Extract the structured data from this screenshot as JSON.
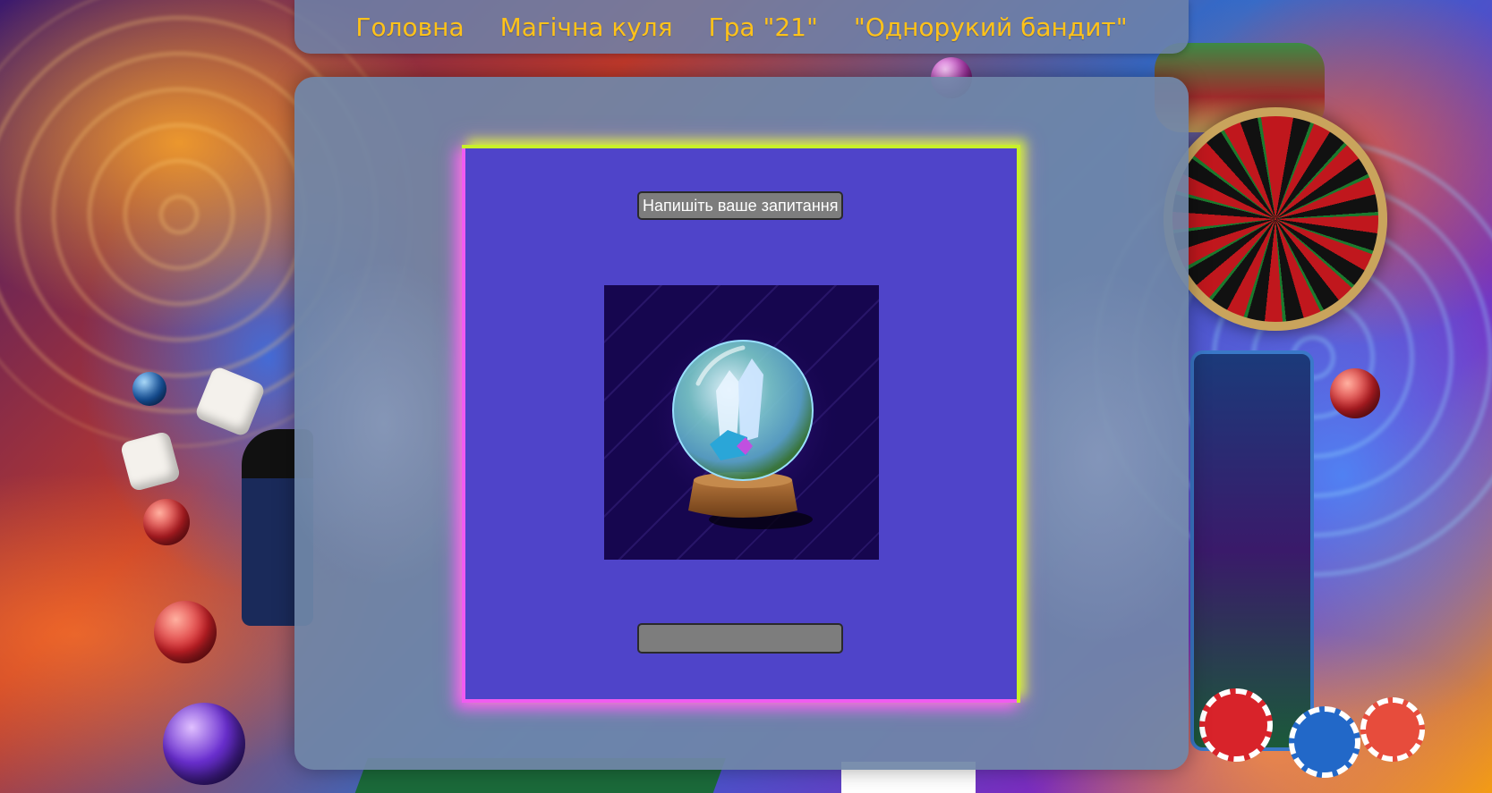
{
  "nav": {
    "items": [
      {
        "label": "Головна"
      },
      {
        "label": "Магічна куля"
      },
      {
        "label": "Гра \"21\""
      },
      {
        "label": "\"Однорукий бандит\""
      }
    ]
  },
  "magic_ball": {
    "question_placeholder": "Напишіть ваше запитання",
    "question_value": "",
    "answer_text": "",
    "image_icon": "crystal-ball-icon"
  },
  "colors": {
    "nav_text": "#ffc21a",
    "card_background": "#4f44c9",
    "glow_top_right": "#c8f02a",
    "glow_bottom_left": "#f05cf0"
  }
}
